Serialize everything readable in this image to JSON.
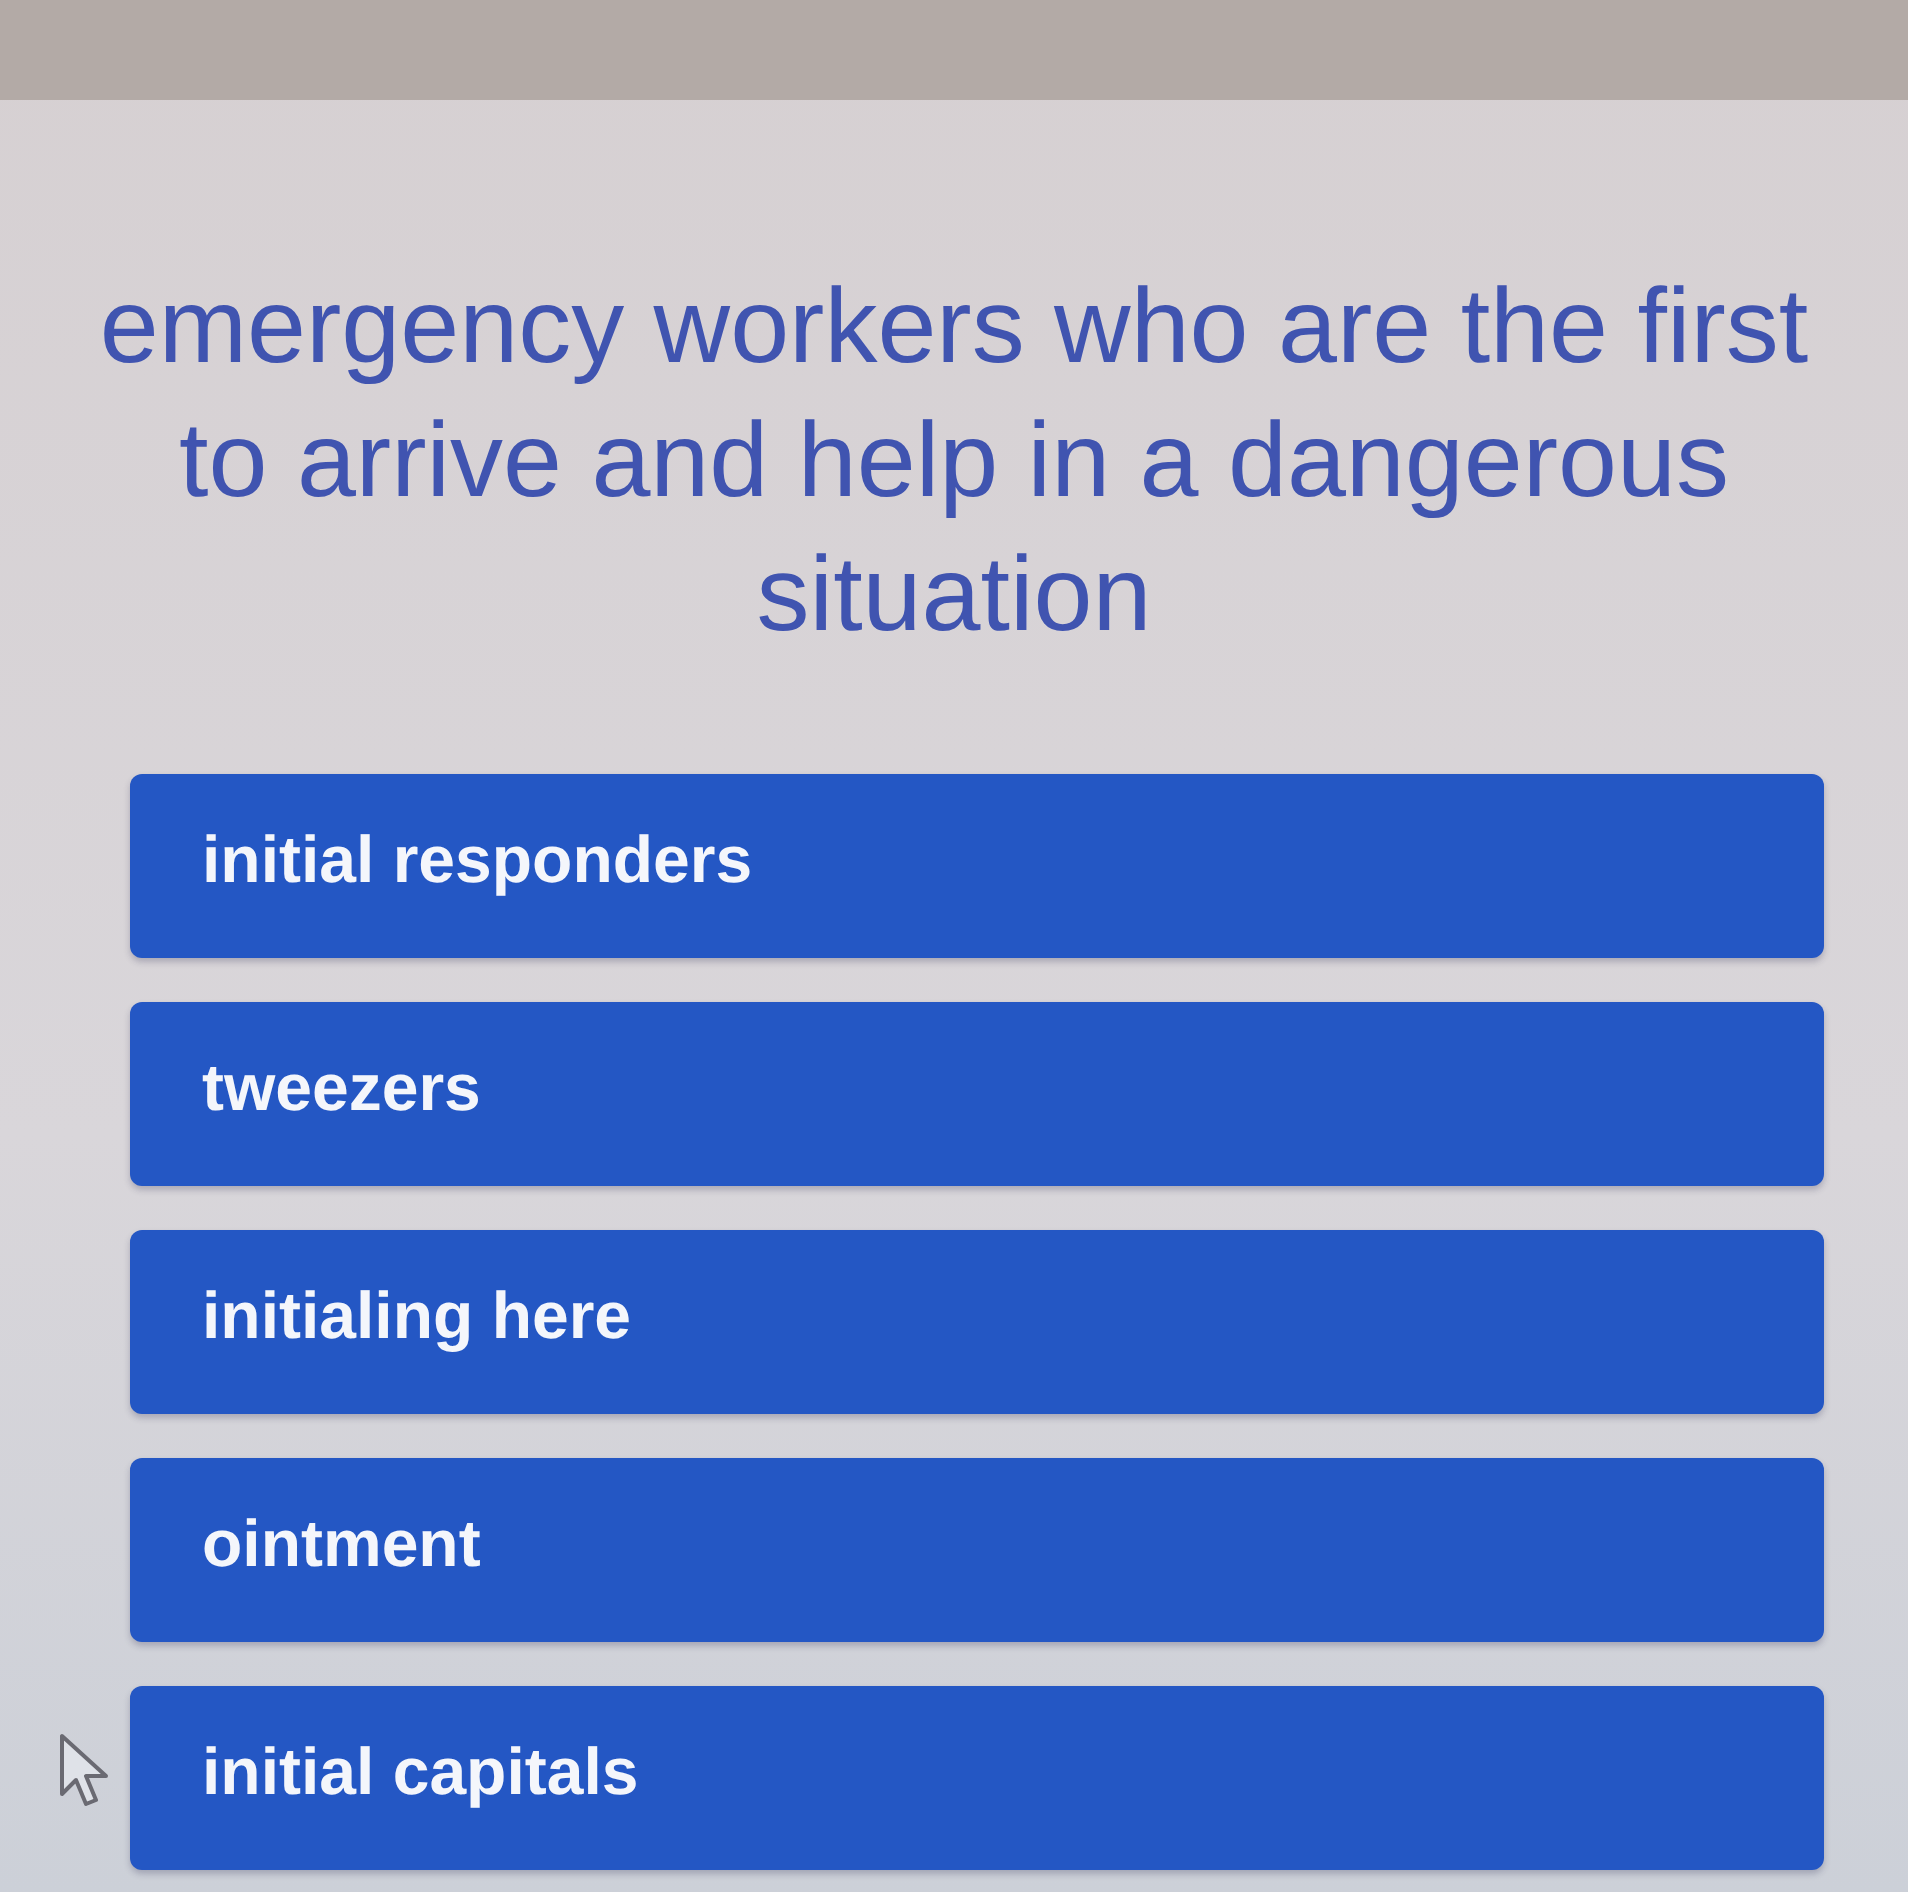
{
  "question": "emergency workers who are the first to arrive and help in a dangerous situation",
  "answers": [
    {
      "label": "initial responders"
    },
    {
      "label": "tweezers"
    },
    {
      "label": "initialing here"
    },
    {
      "label": "ointment"
    },
    {
      "label": "initial capitals"
    }
  ]
}
